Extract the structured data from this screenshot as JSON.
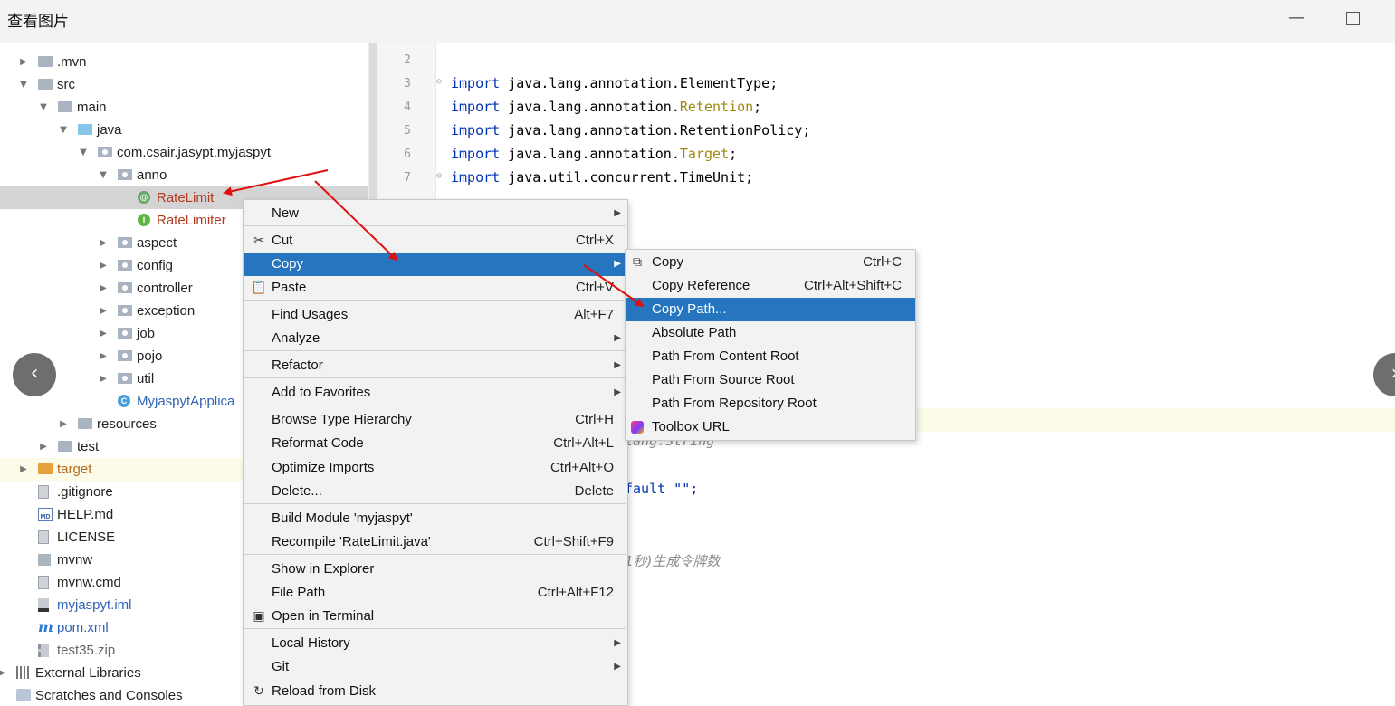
{
  "viewer": {
    "title": "查看图片",
    "minimize_glyph": "—",
    "prev_glyph": "‹",
    "next_glyph": "›"
  },
  "project_tree": [
    {
      "label": ".mvn",
      "arrow": "▶",
      "icon": "folder",
      "depth": 0
    },
    {
      "label": "src",
      "arrow": "▼",
      "icon": "folder",
      "depth": 0
    },
    {
      "label": "main",
      "arrow": "▼",
      "icon": "folder",
      "depth": 1
    },
    {
      "label": "java",
      "arrow": "▼",
      "icon": "folder-blue",
      "depth": 2
    },
    {
      "label": "com.csair.jasypt.myjaspyt",
      "arrow": "▼",
      "icon": "package",
      "depth": 3
    },
    {
      "label": "anno",
      "arrow": "▼",
      "icon": "package",
      "depth": 4
    },
    {
      "label": "RateLimit",
      "icon": "annotation-icon",
      "depth": 5,
      "selected": true
    },
    {
      "label": "RateLimiter",
      "icon": "interface-icon",
      "depth": 5
    },
    {
      "label": "aspect",
      "arrow": "▶",
      "icon": "package",
      "depth": 4
    },
    {
      "label": "config",
      "arrow": "▶",
      "icon": "package",
      "depth": 4
    },
    {
      "label": "controller",
      "arrow": "▶",
      "icon": "package",
      "depth": 4
    },
    {
      "label": "exception",
      "arrow": "▶",
      "icon": "package",
      "depth": 4
    },
    {
      "label": "job",
      "arrow": "▶",
      "icon": "package",
      "depth": 4
    },
    {
      "label": "pojo",
      "arrow": "▶",
      "icon": "package",
      "depth": 4
    },
    {
      "label": "util",
      "arrow": "▶",
      "icon": "package",
      "depth": 4
    },
    {
      "label": "MyjaspytApplica",
      "icon": "spring-class-icon",
      "depth": 4
    },
    {
      "label": "resources",
      "arrow": "▶",
      "icon": "folder",
      "depth": 2
    },
    {
      "label": "test",
      "arrow": "▶",
      "icon": "folder",
      "depth": 1
    },
    {
      "label": "target",
      "arrow": "▶",
      "icon": "folder-orange",
      "depth": 0
    },
    {
      "label": ".gitignore",
      "icon": "file-icon",
      "depth": 0
    },
    {
      "label": "HELP.md",
      "icon": "markdown-icon",
      "depth": 0
    },
    {
      "label": "LICENSE",
      "icon": "text-file-icon",
      "depth": 0
    },
    {
      "label": "mvnw",
      "icon": "terminal-file-icon",
      "depth": 0
    },
    {
      "label": "mvnw.cmd",
      "icon": "text-file-icon",
      "depth": 0
    },
    {
      "label": "myjaspyt.iml",
      "icon": "module-file-icon",
      "depth": 0
    },
    {
      "label": "pom.xml",
      "icon": "maven-icon",
      "depth": 0
    },
    {
      "label": "test35.zip",
      "icon": "zip-icon",
      "depth": 0
    },
    {
      "label": "External Libraries",
      "arrow": "▶",
      "icon": "library-icon",
      "depth": -1
    },
    {
      "label": "Scratches and Consoles",
      "icon": "scratches-icon",
      "depth": -1
    }
  ],
  "editor": {
    "line_numbers": [
      "2",
      "3",
      "4",
      "5",
      "6",
      "7"
    ],
    "imports": [
      {
        "kw": "import",
        "pkg": "java.lang.annotation.",
        "cls": "ElementType",
        "tail": ";"
      },
      {
        "kw": "import",
        "pkg": "java.lang.annotation.",
        "cls": "Retention",
        "tail": ";"
      },
      {
        "kw": "import",
        "pkg": "java.lang.annotation.",
        "cls": "RetentionPolicy",
        "tail": ";"
      },
      {
        "kw": "import",
        "pkg": "java.lang.annotation.",
        "cls": "Target",
        "tail": ";"
      },
      {
        "kw": "import",
        "pkg": "java.util.concurrent.",
        "cls": "TimeUnit",
        "tail": ";"
      }
    ],
    "frag_string": "lang.String",
    "frag_default": "fault \"\";",
    "frag_comment": "1秒)生成令牌数"
  },
  "context_menu": {
    "items": [
      {
        "label": "New",
        "shortcut": "",
        "submenu": true,
        "icon": ""
      },
      {
        "label": "Cut",
        "shortcut": "Ctrl+X",
        "icon": "✂"
      },
      {
        "label": "Copy",
        "shortcut": "",
        "submenu": true,
        "active": true,
        "icon": ""
      },
      {
        "label": "Paste",
        "shortcut": "Ctrl+V",
        "icon": "📋"
      },
      {
        "label": "Find Usages",
        "shortcut": "Alt+F7",
        "icon": ""
      },
      {
        "label": "Analyze",
        "shortcut": "",
        "submenu": true,
        "icon": ""
      },
      {
        "label": "Refactor",
        "shortcut": "",
        "submenu": true,
        "icon": ""
      },
      {
        "label": "Add to Favorites",
        "shortcut": "",
        "submenu": true,
        "icon": ""
      },
      {
        "label": "Browse Type Hierarchy",
        "shortcut": "Ctrl+H",
        "icon": ""
      },
      {
        "label": "Reformat Code",
        "shortcut": "Ctrl+Alt+L",
        "icon": ""
      },
      {
        "label": "Optimize Imports",
        "shortcut": "Ctrl+Alt+O",
        "icon": ""
      },
      {
        "label": "Delete...",
        "shortcut": "Delete",
        "icon": ""
      },
      {
        "label": "Build Module 'myjaspyt'",
        "shortcut": "",
        "icon": ""
      },
      {
        "label": "Recompile 'RateLimit.java'",
        "shortcut": "Ctrl+Shift+F9",
        "icon": ""
      },
      {
        "label": "Show in Explorer",
        "shortcut": "",
        "icon": ""
      },
      {
        "label": "File Path",
        "shortcut": "Ctrl+Alt+F12",
        "icon": ""
      },
      {
        "label": "Open in Terminal",
        "shortcut": "",
        "icon": "▣"
      },
      {
        "label": "Local History",
        "shortcut": "",
        "submenu": true,
        "icon": ""
      },
      {
        "label": "Git",
        "shortcut": "",
        "submenu": true,
        "icon": ""
      },
      {
        "label": "Reload from Disk",
        "shortcut": "",
        "icon": "↻"
      }
    ],
    "submenu_glyph": "▶"
  },
  "copy_submenu": {
    "items": [
      {
        "label": "Copy",
        "shortcut": "Ctrl+C",
        "icon": "copy-icon"
      },
      {
        "label": "Copy Reference",
        "shortcut": "Ctrl+Alt+Shift+C",
        "icon": ""
      },
      {
        "label": "Copy Path...",
        "shortcut": "",
        "active": true,
        "icon": ""
      },
      {
        "label": "Absolute Path",
        "shortcut": "",
        "icon": ""
      },
      {
        "label": "Path From Content Root",
        "shortcut": "",
        "icon": ""
      },
      {
        "label": "Path From Source Root",
        "shortcut": "",
        "icon": ""
      },
      {
        "label": "Path From Repository Root",
        "shortcut": "",
        "icon": ""
      },
      {
        "label": "Toolbox URL",
        "shortcut": "",
        "icon": "toolbox-icon"
      }
    ]
  },
  "colors": {
    "menu_active": "#2675bf",
    "annotation_arrow": "#e01010"
  }
}
